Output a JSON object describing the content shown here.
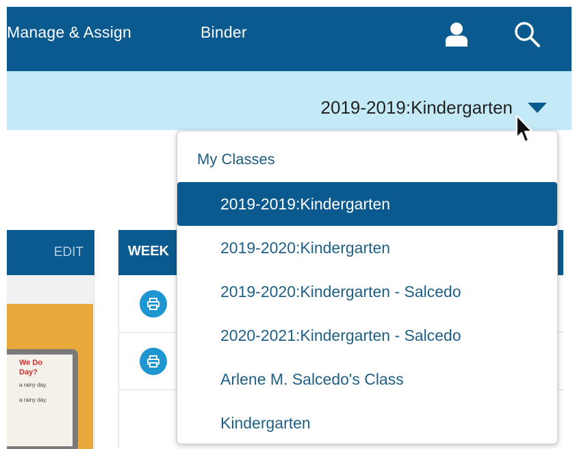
{
  "nav": {
    "links": [
      "Manage & Assign",
      "Binder"
    ],
    "icons": [
      "user-icon",
      "search-icon"
    ]
  },
  "class_selector": {
    "selected_label": "2019-2019:Kindergarten",
    "icon": "caret-down-icon"
  },
  "panels": {
    "left": {
      "edit_label": "EDIT"
    },
    "right": {
      "header_label": "WEEK"
    }
  },
  "thumbnail": {
    "title_line1": "We Do",
    "title_line2": "Day?",
    "line1": "a rainy day.",
    "line2": "a rainy day."
  },
  "dropdown": {
    "heading": "My Classes",
    "items": [
      {
        "label": "2019-2019:Kindergarten",
        "selected": true
      },
      {
        "label": "2019-2020:Kindergarten",
        "selected": false
      },
      {
        "label": "2019-2020:Kindergarten - Salcedo",
        "selected": false
      },
      {
        "label": "2020-2021:Kindergarten - Salcedo",
        "selected": false
      },
      {
        "label": "Arlene M. Salcedo's Class",
        "selected": false
      },
      {
        "label": "Kindergarten",
        "selected": false
      }
    ]
  },
  "colors": {
    "nav_bg": "#0b5a8f",
    "class_bar_bg": "#c4e9f7",
    "link_text": "#1e5f86",
    "print_button": "#1e96d1"
  }
}
